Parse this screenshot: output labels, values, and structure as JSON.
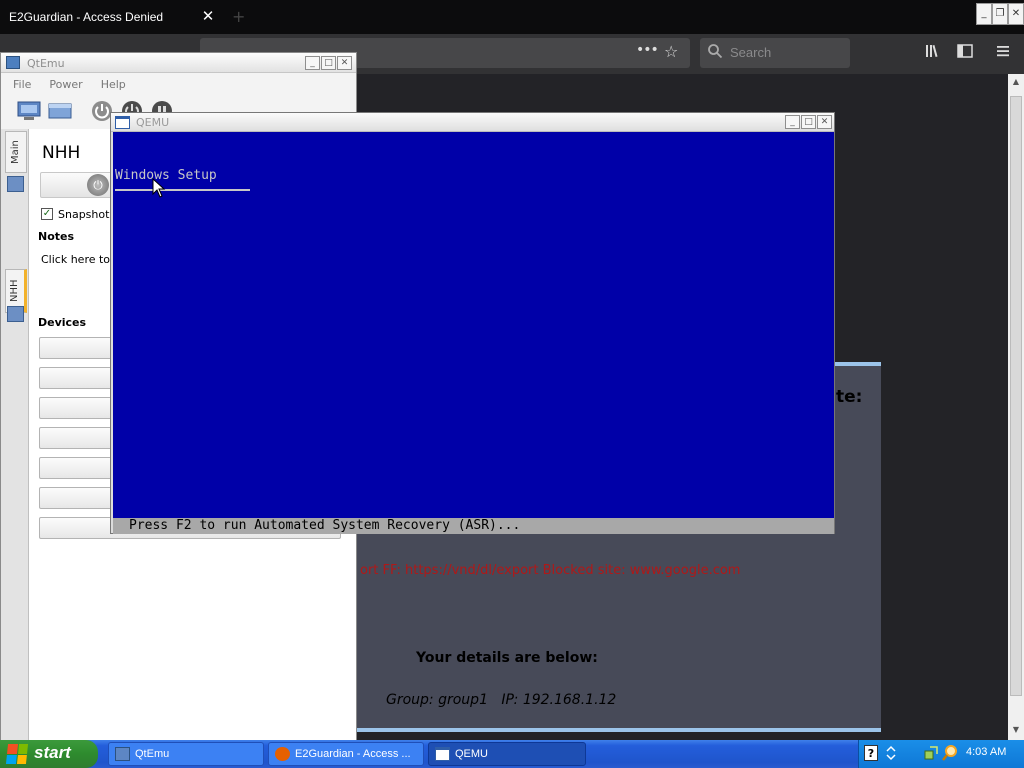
{
  "firefox": {
    "tab_title": "E2Guardian - Access Denied",
    "tab_close": "✕",
    "new_tab": "+",
    "window_controls": [
      "_",
      "❐",
      "✕"
    ],
    "search_placeholder": "Search",
    "page_action_dots": "•••",
    "bookmark_star": "☆",
    "site_suffix": "te:",
    "red_reason": "ort FF: https://vnd/dl/export  Blocked site: www.google.com",
    "details_heading": "Your details are below:",
    "details_line": "Group: group1   IP: 192.168.1.12",
    "scroll_up": "▲",
    "scroll_down": "▼"
  },
  "qtemu": {
    "title": "QtEmu",
    "window_controls": [
      "_",
      "□",
      "✕"
    ],
    "menu": [
      "File",
      "Power",
      "Help"
    ],
    "side_tabs": {
      "main": "Main",
      "nhh": "NHH"
    },
    "vm_name": "NHH",
    "power_icon": "⏻",
    "snapshot_checked": "✓",
    "snapshot_label": "Snapshot mode",
    "notes_heading": "Notes",
    "notes_text": "Click here to write notes",
    "devices_heading": "Devices"
  },
  "qemu": {
    "title": "QEMU",
    "window_controls": [
      "_",
      "□",
      "✕"
    ],
    "screen_title": "Windows Setup",
    "status_text": "Press F2 to run Automated System Recovery (ASR)...",
    "screen_bg": "#0000a8",
    "status_bg": "#a8a8a8"
  },
  "taskbar": {
    "start_label": "start",
    "tasks": [
      {
        "label": "QtEmu"
      },
      {
        "label": "E2Guardian - Access ..."
      },
      {
        "label": "QEMU"
      }
    ],
    "tray_help": "?",
    "clock": "4:03 AM"
  }
}
